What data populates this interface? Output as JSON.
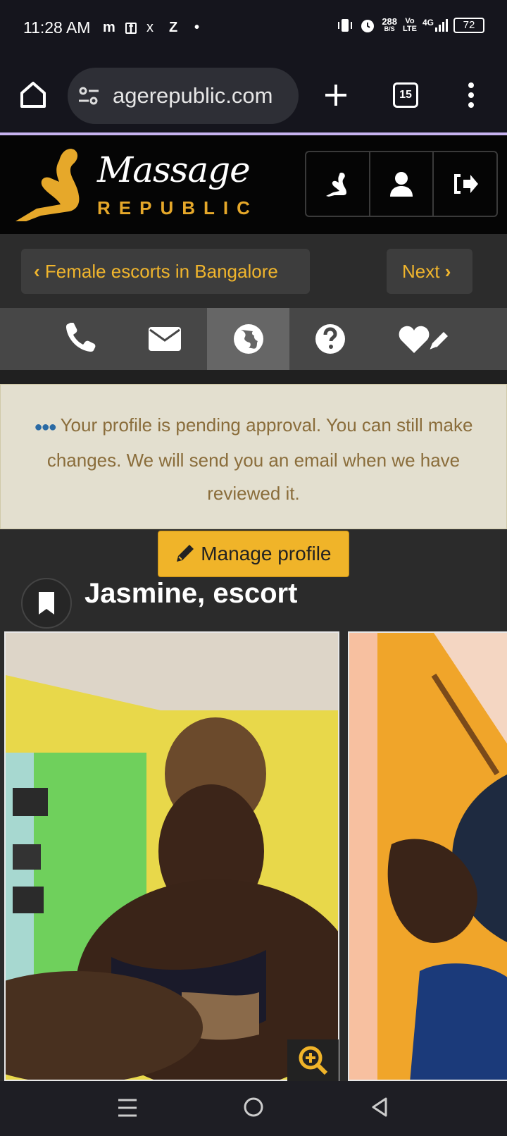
{
  "status": {
    "time": "11:28 AM",
    "indicators": [
      "m",
      "f",
      "x",
      "Z",
      "•"
    ],
    "net_speed": "288",
    "net_unit": "B/S",
    "volte": "Vo",
    "lte": "LTE",
    "signal": "4G",
    "battery": "72"
  },
  "browser": {
    "url": "agerepublic.com",
    "tab_count": "15"
  },
  "site": {
    "logo_script": "Massage",
    "logo_sub": "REPUBLIC",
    "accent": "#e6a82a"
  },
  "nav": {
    "back_label": "Female escorts in Bangalore",
    "next_label": "Next"
  },
  "notice": {
    "text": "Your profile is pending approval. You can still make changes. We will send you an email when we have reviewed it."
  },
  "profile": {
    "manage_label": "Manage profile",
    "title": "Jasmine, escort"
  },
  "tabs": [
    "phone-icon",
    "email-icon",
    "globe-icon",
    "question-icon",
    "heart-edit-icon"
  ]
}
